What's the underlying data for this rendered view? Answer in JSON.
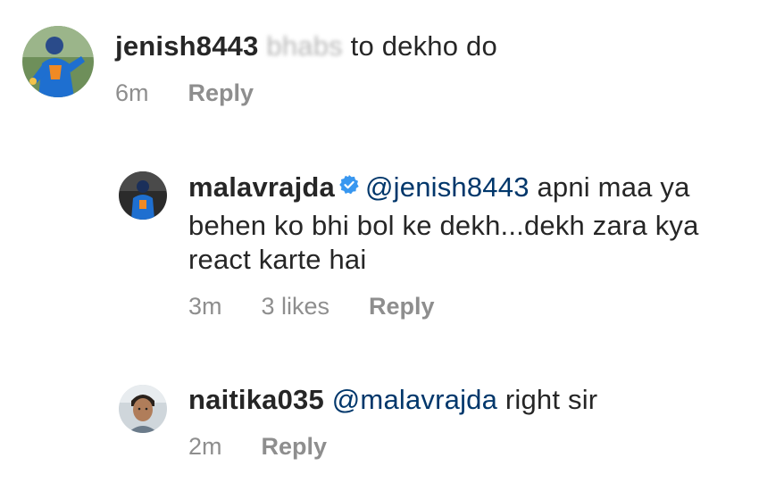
{
  "comments": [
    {
      "username": "jenish8443",
      "blurred_text": "bhabs",
      "text": " to dekho do",
      "time": "6m",
      "reply_label": "Reply",
      "avatar_icon": "cricketer-avatar"
    },
    {
      "username": "malavrajda",
      "verified_icon": "verified-badge-icon",
      "mention": "@jenish8443",
      "text": " apni maa ya behen ko bhi bol ke dekh...dekh zara kya react karte hai",
      "time": "3m",
      "likes": "3 likes",
      "reply_label": "Reply",
      "avatar_icon": "cricketer-avatar"
    },
    {
      "username": "naitika035",
      "mention": "@malavrajda",
      "text": " right sir",
      "time": "2m",
      "reply_label": "Reply",
      "avatar_icon": "person-avatar"
    }
  ],
  "colors": {
    "username": "#262626",
    "mention": "#00376b",
    "meta": "#8e8e8e",
    "verified": "#3897f0"
  }
}
